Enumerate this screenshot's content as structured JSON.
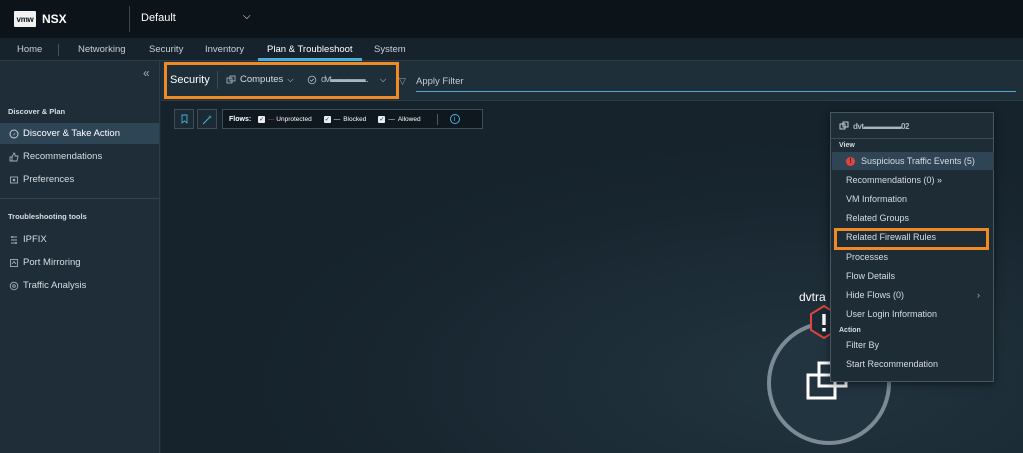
{
  "header": {
    "logo_text": "vmw",
    "app_name": "NSX",
    "tenant": "Default"
  },
  "nav": {
    "tabs": [
      "Home",
      "Networking",
      "Security",
      "Inventory",
      "Plan & Troubleshoot",
      "System"
    ],
    "active_tab": "Plan & Troubleshoot"
  },
  "sidebar": {
    "collapse_icon": "double-chevron-left-icon",
    "section1": "Discover & Plan",
    "section1_items": [
      {
        "label": "Discover & Take Action",
        "icon": "discover-icon",
        "active": true
      },
      {
        "label": "Recommendations",
        "icon": "recommendations-icon"
      },
      {
        "label": "Preferences",
        "icon": "preferences-icon"
      }
    ],
    "section2": "Troubleshooting tools",
    "section2_items": [
      {
        "label": "IPFIX",
        "icon": "ipfix-icon"
      },
      {
        "label": "Port Mirroring",
        "icon": "port-mirroring-icon"
      },
      {
        "label": "Traffic Analysis",
        "icon": "traffic-analysis-icon"
      }
    ]
  },
  "filter": {
    "scope": "Security",
    "compute": "Computes",
    "vm": "dvt▬▬▬▬..",
    "apply_placeholder": "Apply Filter"
  },
  "flows": {
    "label": "Flows:",
    "options": [
      {
        "name": "Unprotected",
        "line": "- - -",
        "color": "#e0443c"
      },
      {
        "name": "Blocked",
        "line": "—",
        "color": "#ffffff"
      },
      {
        "name": "Allowed",
        "line": "—",
        "color": "#ffffff"
      }
    ]
  },
  "node": {
    "label": "dvtra"
  },
  "context_menu": {
    "vm_name": "dvt▬▬▬▬▬02",
    "view_section": "View",
    "view_items": [
      {
        "label": "Suspicious Traffic Events (5)",
        "warning": true,
        "selected": true
      },
      {
        "label": "Recommendations (0) »"
      },
      {
        "label": "VM Information"
      },
      {
        "label": "Related Groups"
      },
      {
        "label": "Related Firewall Rules",
        "highlighted": true
      },
      {
        "label": "Processes"
      },
      {
        "label": "Flow Details"
      },
      {
        "label": "Hide Flows (0)",
        "submenu": true
      },
      {
        "label": "User Login Information"
      }
    ],
    "action_section": "Action",
    "action_items": [
      {
        "label": "Filter By"
      },
      {
        "label": "Start Recommendation"
      }
    ]
  },
  "colors": {
    "accent": "#49afd9",
    "highlight": "#f08a24",
    "warning": "#e0443c"
  }
}
